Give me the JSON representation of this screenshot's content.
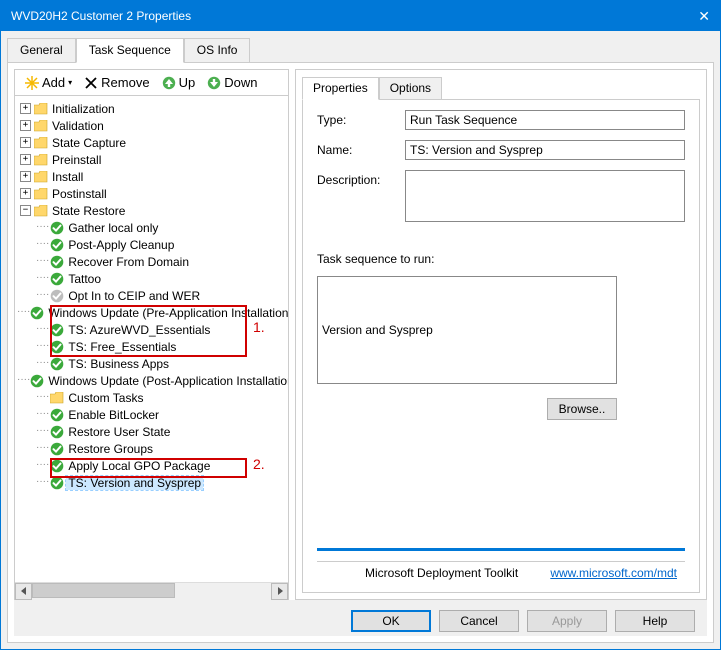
{
  "window": {
    "title": "WVD20H2 Customer 2 Properties",
    "close": "✕"
  },
  "topTabs": {
    "general": "General",
    "taskSequence": "Task Sequence",
    "osInfo": "OS Info"
  },
  "toolbar": {
    "add": "Add",
    "remove": "Remove",
    "up": "Up",
    "down": "Down",
    "add_arrow": "▾"
  },
  "tree": {
    "roots": [
      {
        "label": "Initialization",
        "icon": "folder",
        "toggle": "+"
      },
      {
        "label": "Validation",
        "icon": "folder",
        "toggle": "+"
      },
      {
        "label": "State Capture",
        "icon": "folder",
        "toggle": "+"
      },
      {
        "label": "Preinstall",
        "icon": "folder",
        "toggle": "+"
      },
      {
        "label": "Install",
        "icon": "folder",
        "toggle": "+"
      },
      {
        "label": "Postinstall",
        "icon": "folder",
        "toggle": "+"
      },
      {
        "label": "State Restore",
        "icon": "folder",
        "toggle": "−"
      }
    ],
    "stateRestoreChildren": [
      {
        "label": "Gather local only",
        "icon": "check"
      },
      {
        "label": "Post-Apply Cleanup",
        "icon": "check"
      },
      {
        "label": "Recover From Domain",
        "icon": "check"
      },
      {
        "label": "Tattoo",
        "icon": "check"
      },
      {
        "label": "Opt In to CEIP and WER",
        "icon": "gray"
      },
      {
        "label": "Windows Update (Pre-Application Installation)",
        "icon": "check"
      },
      {
        "label": "TS: AzureWVD_Essentials",
        "icon": "check"
      },
      {
        "label": "TS: Free_Essentials",
        "icon": "check"
      },
      {
        "label": "TS: Business Apps",
        "icon": "check"
      },
      {
        "label": "Windows Update (Post-Application Installation)",
        "icon": "check"
      },
      {
        "label": "Custom Tasks",
        "icon": "folderSmall"
      },
      {
        "label": "Enable BitLocker",
        "icon": "check"
      },
      {
        "label": "Restore User State",
        "icon": "check"
      },
      {
        "label": "Restore Groups",
        "icon": "check"
      },
      {
        "label": "Apply Local GPO Package",
        "icon": "check"
      },
      {
        "label": "TS: Version and Sysprep",
        "icon": "check",
        "selected": true
      }
    ]
  },
  "propTabs": {
    "properties": "Properties",
    "options": "Options"
  },
  "form": {
    "typeLabel": "Type:",
    "typeValue": "Run Task Sequence",
    "nameLabel": "Name:",
    "nameValue": "TS: Version and Sysprep",
    "descLabel": "Description:",
    "descValue": "",
    "seqLabel": "Task sequence to run:",
    "seqValue": "Version and Sysprep",
    "browse": "Browse.."
  },
  "footer": {
    "brand": "Microsoft Deployment Toolkit",
    "linkText": "www.microsoft.com/mdt"
  },
  "buttons": {
    "ok": "OK",
    "cancel": "Cancel",
    "apply": "Apply",
    "help": "Help"
  },
  "annotations": {
    "one": "1.",
    "two": "2."
  }
}
